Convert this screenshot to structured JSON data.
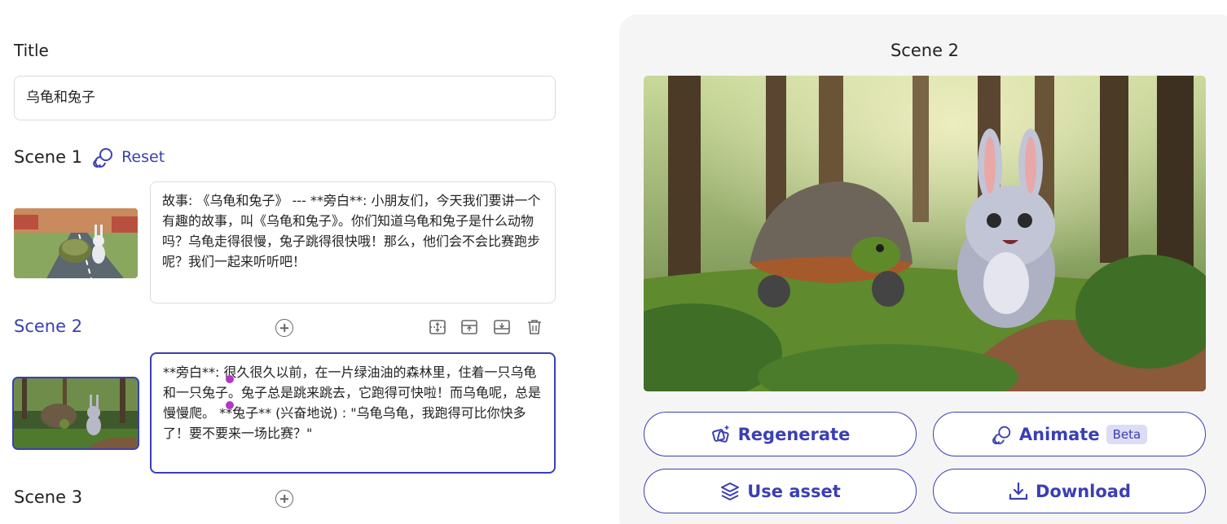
{
  "editor": {
    "title_label": "Title",
    "title_value": "乌龟和兔子"
  },
  "scenes": [
    {
      "label": "Scene 1",
      "reset_label": "Reset",
      "text": "故事: 《乌龟和兔子》 --- **旁白**: 小朋友们，今天我们要讲一个有趣的故事，叫《乌龟和兔子》。你们知道乌龟和兔子是什么动物吗？乌龟走得很慢，兔子跳得很快哦！那么，他们会不会比赛跑步呢？我们一起来听听吧！"
    },
    {
      "label": "Scene 2",
      "text": "**旁白**: 很久很久以前，在一片绿油油的森林里，住着一只乌龟和一只兔子。兔子总是跳来跳去，它跑得可快啦！而乌龟呢，总是慢慢爬。 **兔子** (兴奋地说) : \"乌龟乌龟，我跑得可比你快多了！要不要来一场比赛？\""
    },
    {
      "label": "Scene 3"
    }
  ],
  "preview": {
    "title": "Scene 2",
    "buttons": {
      "regenerate": "Regenerate",
      "animate": "Animate",
      "beta": "Beta",
      "use_asset": "Use asset",
      "download": "Download"
    }
  },
  "colors": {
    "accent": "#3b3fb3",
    "panel": "#f5f5f5"
  }
}
